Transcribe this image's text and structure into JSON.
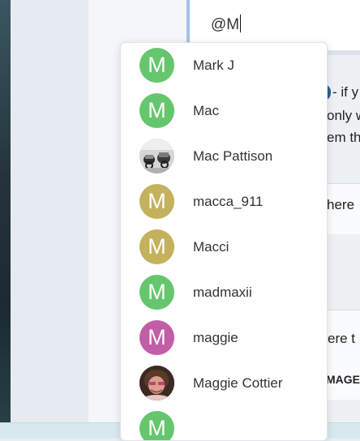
{
  "editor": {
    "input_text": "@M"
  },
  "background": {
    "frag_if": "- if y",
    "frag_only": "only w",
    "frag_em": "em th",
    "frag_here1": "here",
    "frag_here2": "ere t",
    "frag_mage": "MAGE"
  },
  "colors": {
    "green": "#66c66e",
    "gold": "#c4b15d",
    "magenta": "#c25ea8"
  },
  "mention_list": {
    "items": [
      {
        "name": "Mark J",
        "initial": "M",
        "avatar": "letter",
        "color": "#66c66e"
      },
      {
        "name": "Mac",
        "initial": "M",
        "avatar": "letter",
        "color": "#66c66e"
      },
      {
        "name": "Mac Pattison",
        "initial": "",
        "avatar": "photo-motorbikes",
        "color": "#bdbdbd"
      },
      {
        "name": "macca_911",
        "initial": "M",
        "avatar": "letter",
        "color": "#c4b15d"
      },
      {
        "name": "Macci",
        "initial": "M",
        "avatar": "letter",
        "color": "#c4b15d"
      },
      {
        "name": "madmaxii",
        "initial": "M",
        "avatar": "letter",
        "color": "#66c66e"
      },
      {
        "name": "maggie",
        "initial": "M",
        "avatar": "letter",
        "color": "#c25ea8"
      },
      {
        "name": "Maggie Cottier",
        "initial": "",
        "avatar": "photo-portrait",
        "color": "#6b4a3a"
      },
      {
        "name": "",
        "initial": "M",
        "avatar": "letter",
        "color": "#66c66e"
      }
    ]
  }
}
